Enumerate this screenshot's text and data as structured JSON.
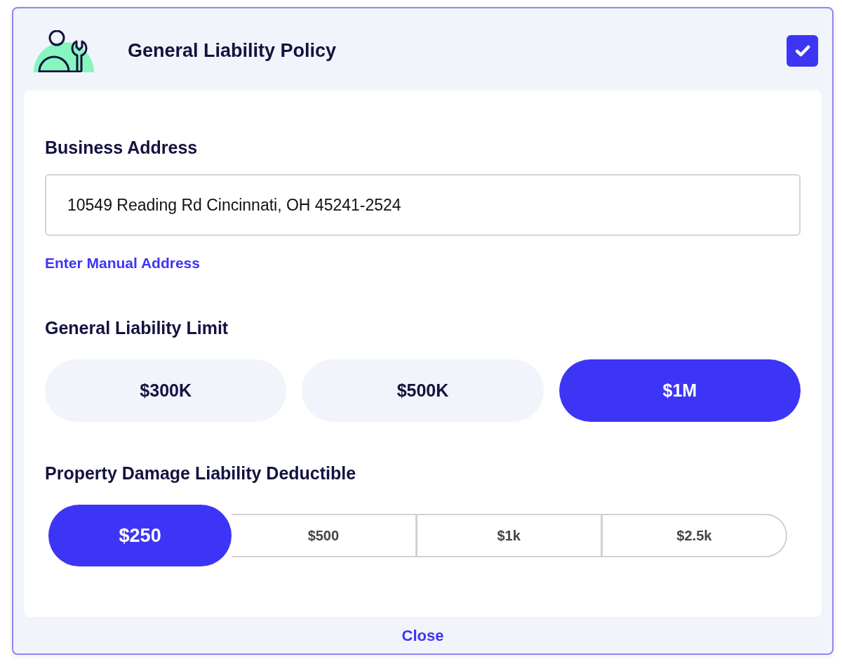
{
  "header": {
    "title": "General Liability Policy",
    "checked": true
  },
  "business_address": {
    "label": "Business Address",
    "value": "10549 Reading Rd Cincinnati, OH 45241-2524",
    "link": "Enter Manual Address"
  },
  "liability_limit": {
    "label": "General Liability Limit",
    "options": [
      {
        "label": "$300K",
        "selected": false
      },
      {
        "label": "$500K",
        "selected": false
      },
      {
        "label": "$1M",
        "selected": true
      }
    ]
  },
  "deductible": {
    "label": "Property Damage Liability Deductible",
    "options": [
      {
        "label": "$250",
        "selected": true
      },
      {
        "label": "$500",
        "selected": false
      },
      {
        "label": "$1k",
        "selected": false
      },
      {
        "label": "$2.5k",
        "selected": false
      }
    ]
  },
  "footer": {
    "close": "Close"
  }
}
